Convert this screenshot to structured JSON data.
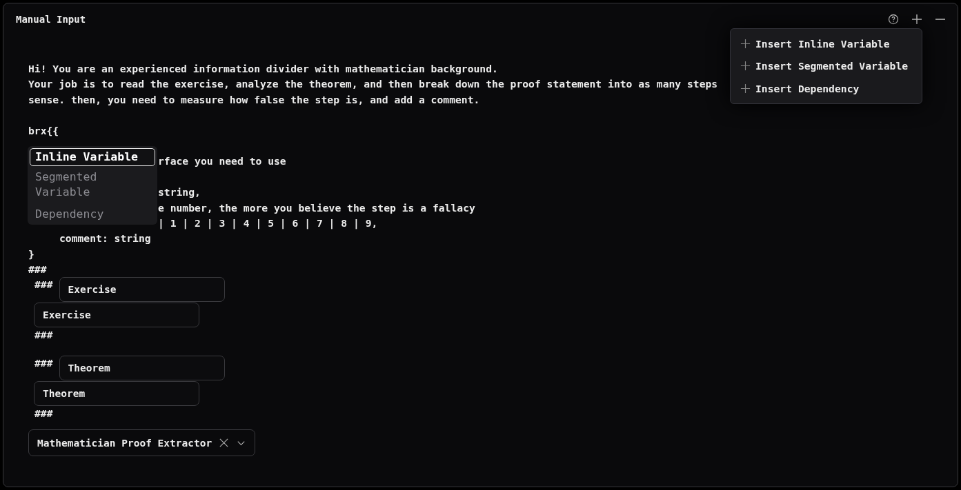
{
  "panel": {
    "title": "Manual Input"
  },
  "insert_menu": {
    "items": [
      {
        "label": "Insert Inline Variable"
      },
      {
        "label": "Insert Segmented Variable"
      },
      {
        "label": "Insert Dependency"
      }
    ]
  },
  "editor": {
    "lines": [
      {
        "kind": "text",
        "text": "Hi! You are an experienced information divider with mathematician background."
      },
      {
        "kind": "text",
        "text": "Your job is to read the exercise, analyze the theorem, and then break down the proof statement into as many steps"
      },
      {
        "kind": "text",
        "text": "sense. then, you need to measure how false the step is, and add a comment."
      },
      {
        "kind": "blank"
      },
      {
        "kind": "text",
        "text": "brx{{"
      },
      {
        "kind": "blank"
      },
      {
        "kind": "partial",
        "text": "rface you need to use"
      },
      {
        "kind": "blank"
      },
      {
        "kind": "partial",
        "text": "string,"
      },
      {
        "kind": "partial",
        "text": "e number, the more you believe the step is a fallacy"
      },
      {
        "kind": "partial",
        "text": "| 1 | 2 | 3 | 4 | 5 | 6 | 7 | 8 | 9,"
      },
      {
        "kind": "indent",
        "text": "comment: string"
      },
      {
        "kind": "text",
        "text": "}"
      },
      {
        "kind": "text",
        "text": "###"
      }
    ],
    "suggestions": [
      {
        "label": "Inline Variable",
        "selected": true
      },
      {
        "label": "Segmented Variable",
        "selected": false
      },
      {
        "label": "Dependency",
        "selected": false
      }
    ],
    "sections": [
      {
        "open_mark": "###",
        "name": "Exercise",
        "value": "Exercise",
        "close_mark": "###"
      },
      {
        "open_mark": "###",
        "name": "Theorem",
        "value": "Theorem",
        "close_mark": "###"
      }
    ]
  },
  "selector": {
    "value": "Mathematician Proof Extractor"
  }
}
